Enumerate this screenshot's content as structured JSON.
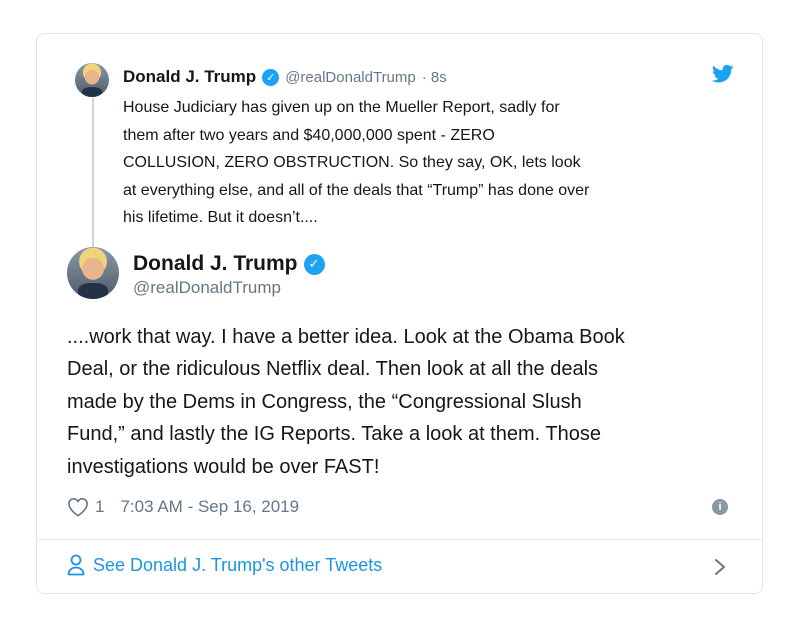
{
  "quoted_tweet": {
    "name": "Donald J. Trump",
    "handle": "@realDonaldTrump",
    "time": "· 8s",
    "lines": [
      "House Judiciary has given up on the Mueller Report, sadly for",
      "them after two years and $40,000,000 spent - ZERO",
      "COLLUSION, ZERO OBSTRUCTION. So they say, OK, lets look",
      "at everything else, and all of the deals that “Trump” has done over",
      "his lifetime. But it doesn’t...."
    ]
  },
  "main_tweet": {
    "name": "Donald J. Trump",
    "handle": "@realDonaldTrump",
    "lines": [
      "....work that way. I have a better idea. Look at the Obama Book",
      "Deal, or the ridiculous Netflix deal. Then look at all the deals",
      "made by the Dems in Congress, the “Congressional Slush",
      "Fund,” and lastly the IG Reports. Take a look at them. Those",
      "investigations would be over FAST!"
    ],
    "like_count": "1",
    "timestamp": "7:03 AM - Sep 16, 2019"
  },
  "footer": {
    "link_label": "See Donald J. Trump's other Tweets"
  },
  "icons": {
    "verified": "verified-badge-icon",
    "bird": "twitter-bird-icon",
    "heart": "heart-icon",
    "info": "info-icon",
    "person": "person-icon",
    "chevron": "chevron-right-icon"
  },
  "colors": {
    "accent": "#1da1f2",
    "link": "#1b95e0",
    "secondary_text": "#657786"
  }
}
